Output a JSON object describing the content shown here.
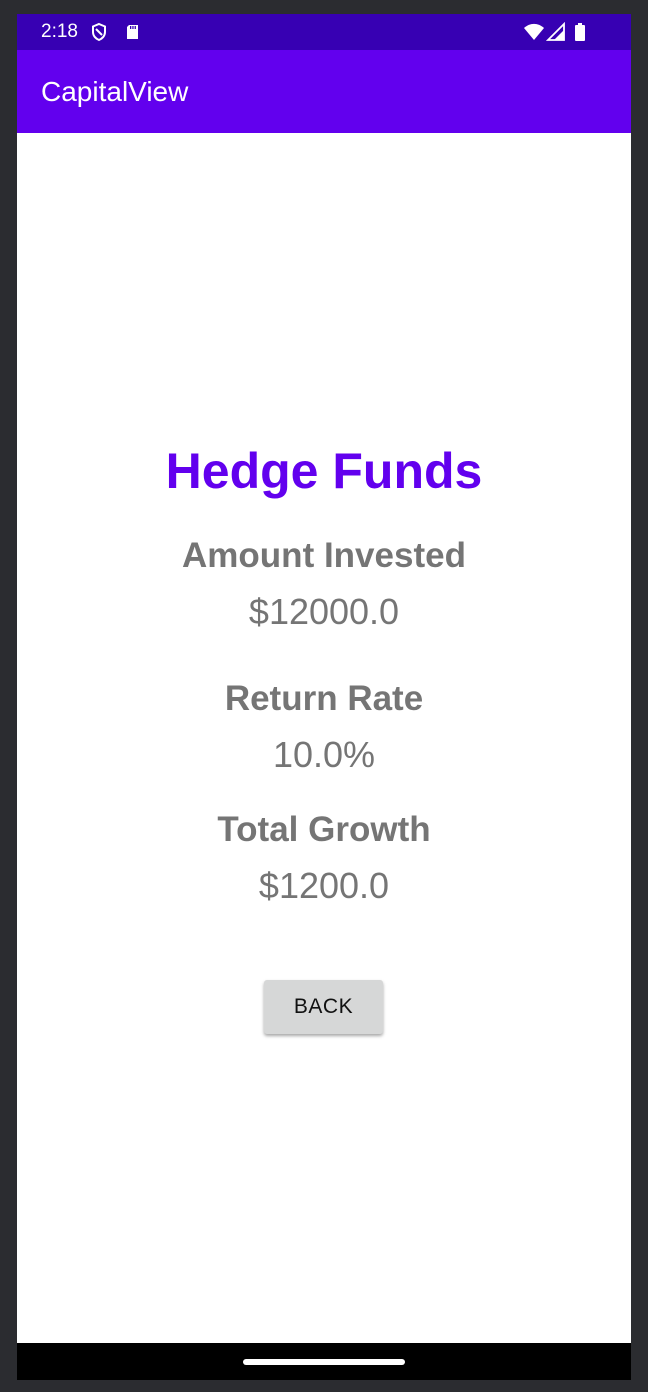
{
  "status_bar": {
    "time": "2:18",
    "icons_left": [
      "shield-icon",
      "sd-card-icon"
    ],
    "icons_right": [
      "wifi-icon",
      "cellular-signal-icon",
      "battery-icon"
    ],
    "background": "#3700b3"
  },
  "app_bar": {
    "title": "CapitalView",
    "background": "#6200ee"
  },
  "investment": {
    "name": "Hedge Funds",
    "amount_label": "Amount Invested",
    "amount_value": "$12000.0",
    "rate_label": "Return Rate",
    "rate_value": "10.0%",
    "growth_label": "Total Growth",
    "growth_value": "$1200.0"
  },
  "actions": {
    "back_label": "BACK"
  },
  "colors": {
    "accent": "#6200ee",
    "text_secondary": "#757575",
    "button_bg": "#d6d7d7"
  }
}
